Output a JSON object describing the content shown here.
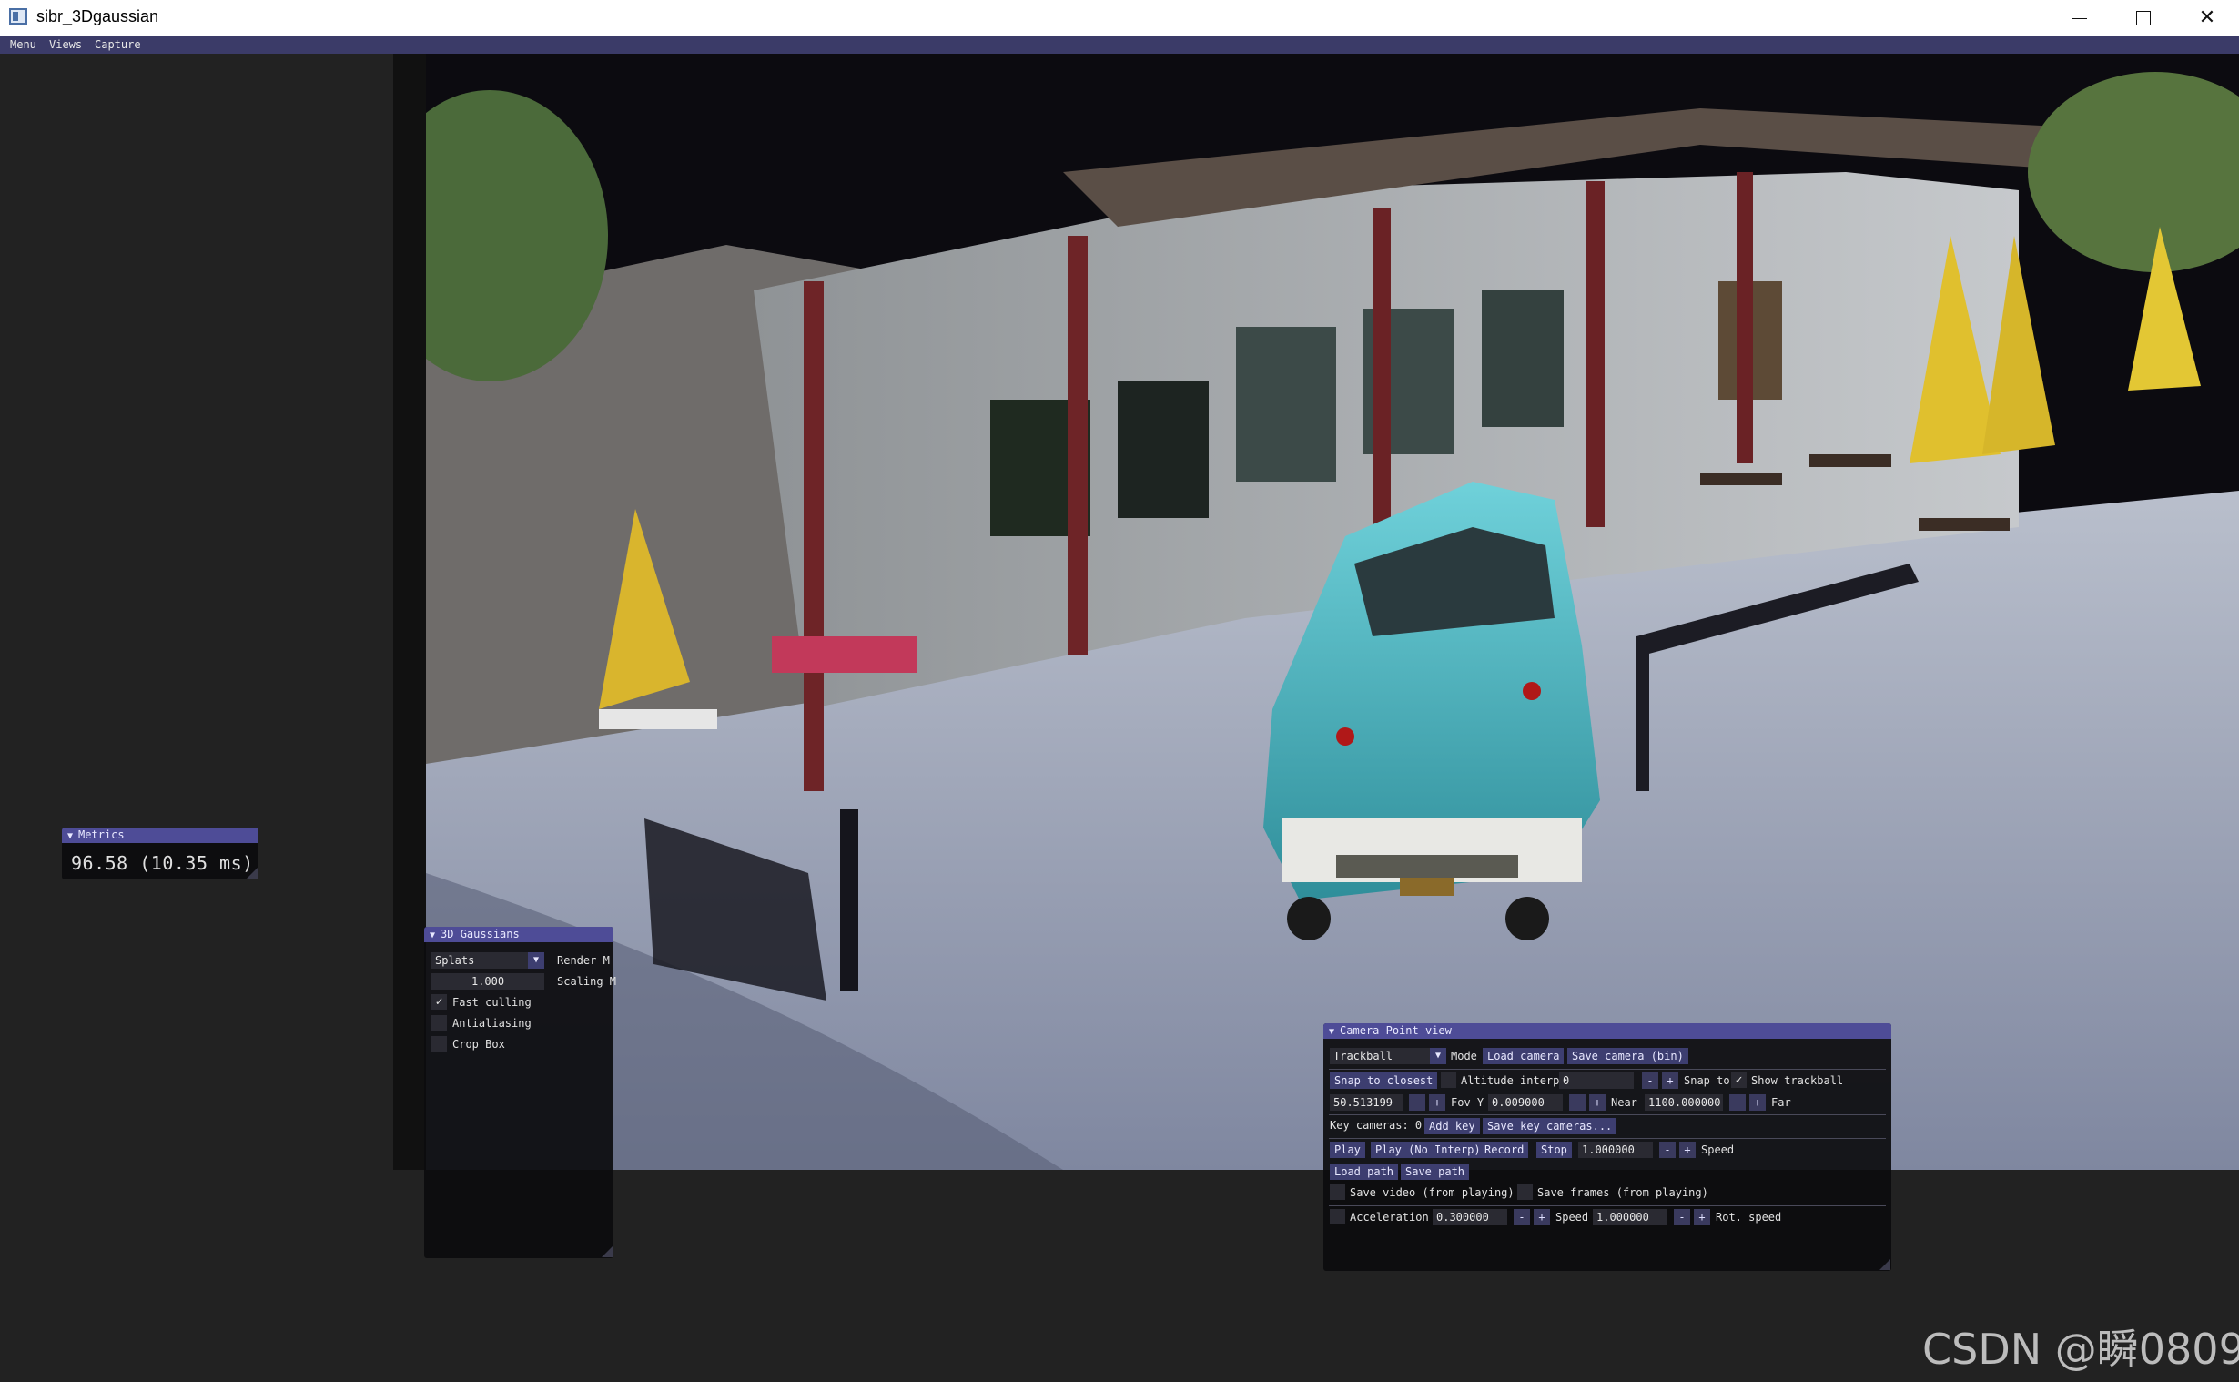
{
  "window": {
    "title": "sibr_3Dgaussian",
    "minimize_glyph": "",
    "maximize_glyph": "",
    "close_glyph": "✕"
  },
  "menubar": {
    "items": [
      "Menu",
      "Views",
      "Capture"
    ]
  },
  "metrics": {
    "title": "Metrics",
    "value": "96.58 (10.35 ms)"
  },
  "gaussians": {
    "title": "3D Gaussians",
    "render_mode_value": "Splats",
    "render_mode_label": "Render M",
    "scaling_value": "1.000",
    "scaling_label": "Scaling M",
    "fast_culling_label": "Fast culling",
    "fast_culling_checked": "✓",
    "antialiasing_label": "Antialiasing",
    "antialiasing_checked": "",
    "crop_box_label": "Crop Box",
    "crop_box_checked": ""
  },
  "camera": {
    "title": "Camera Point view",
    "mode_value": "Trackball",
    "mode_label": "Mode",
    "load_camera": "Load camera",
    "save_camera": "Save camera (bin)",
    "snap_to_closest": "Snap to closest",
    "altitude_interp_label": "Altitude interp",
    "altitude_interp_value": "0",
    "snap_to_label": "Snap to",
    "show_trackball_label": "Show trackball",
    "show_trackball_checked": "✓",
    "fov_x_value": "50.513199",
    "fov_y_label": "Fov Y",
    "fov_y_value": "0.009000",
    "near_label": "Near",
    "near_value": "1100.000000",
    "far_label": "Far",
    "key_cameras": "Key cameras: 0",
    "add_key": "Add key",
    "save_key_cameras": "Save key cameras...",
    "play": "Play",
    "play_no_interp": "Play (No Interp)",
    "record": "Record",
    "stop": "Stop",
    "play_speed_value": "1.000000",
    "speed_label": "Speed",
    "load_path": "Load path",
    "save_path": "Save path",
    "save_video_label": "Save video (from playing)",
    "save_frames_label": "Save frames (from playing)",
    "acceleration_label": "Acceleration",
    "acceleration_value": "0.300000",
    "move_speed_label": "Speed",
    "move_speed_value": "1.000000",
    "rot_speed_label": "Rot. speed",
    "minus": "-",
    "plus": "+"
  },
  "watermark": "CSDN @瞬0809",
  "colors": {
    "menubar_bg": "#3b3b68",
    "imgui_title_bg": "#4e4c97",
    "imgui_button_bg": "#3d3e70",
    "app_bg": "#222222"
  }
}
